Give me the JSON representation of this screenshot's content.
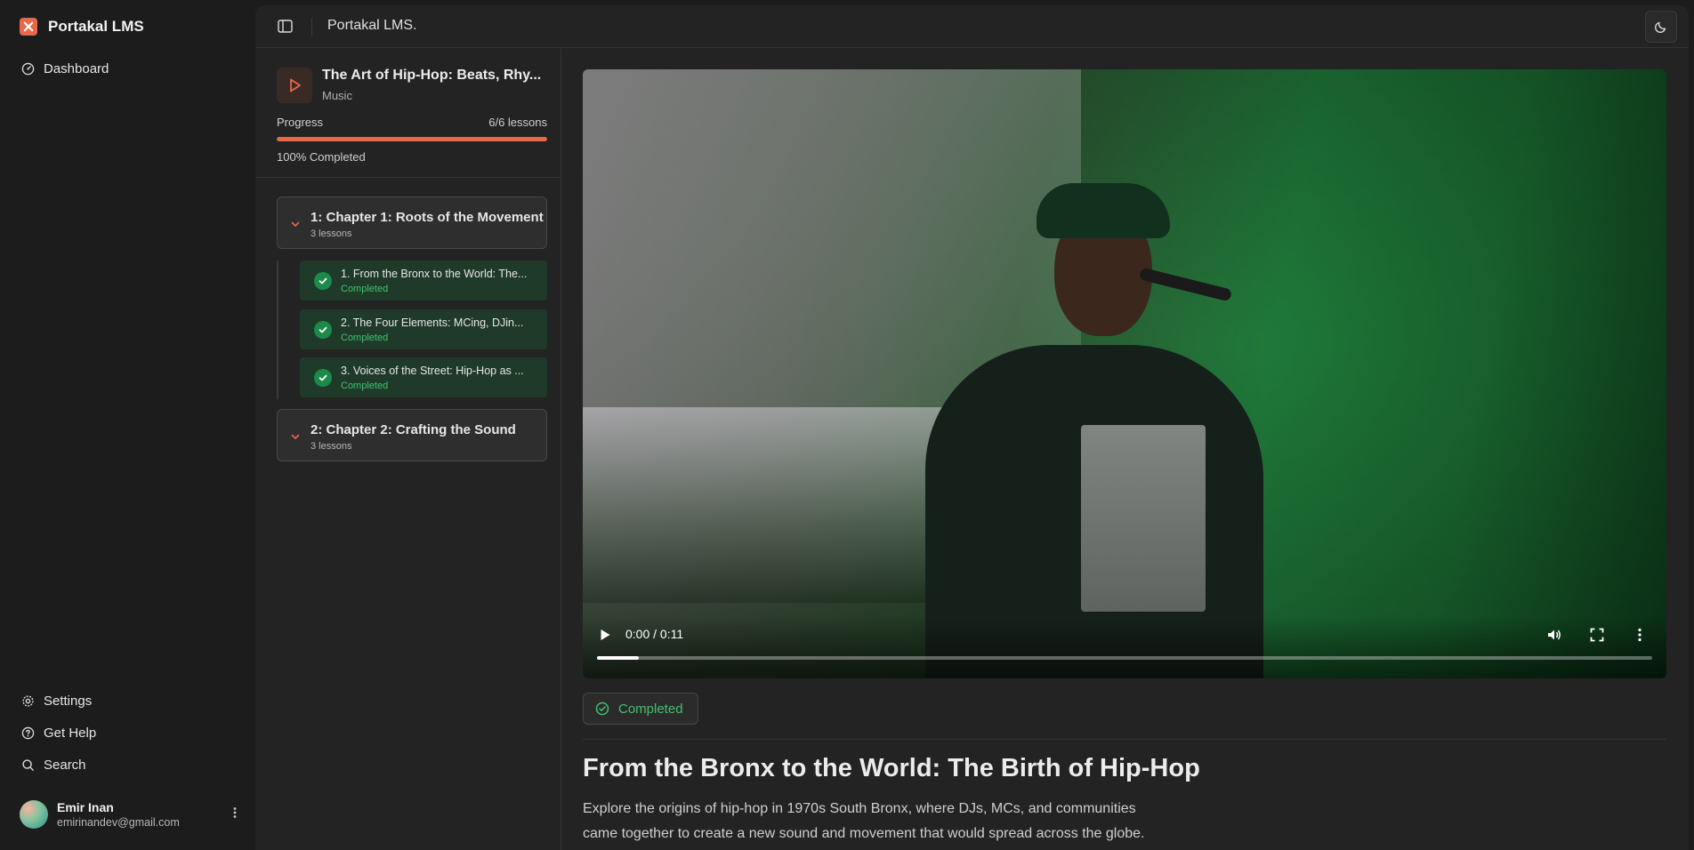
{
  "app": {
    "brand": "Portakal LMS",
    "topbar_title": "Portakal LMS."
  },
  "sidebar": {
    "nav": [
      {
        "label": "Dashboard",
        "icon": "dashboard-icon"
      }
    ],
    "footer_nav": [
      {
        "label": "Settings",
        "icon": "gear-icon"
      },
      {
        "label": "Get Help",
        "icon": "help-icon"
      },
      {
        "label": "Search",
        "icon": "search-icon"
      }
    ],
    "user": {
      "name": "Emir Inan",
      "email": "emirinandev@gmail.com"
    }
  },
  "course": {
    "title": "The Art of Hip-Hop: Beats, Rhy...",
    "category": "Music",
    "progress_label": "Progress",
    "progress_count": "6/6 lessons",
    "progress_fraction": 1.0,
    "progress_text": "100% Completed",
    "chapters": [
      {
        "title": "1: Chapter 1: Roots of the Movement",
        "count": "3 lessons",
        "lessons": [
          {
            "title": "1. From the Bronx to the World: The...",
            "status": "Completed"
          },
          {
            "title": "2. The Four Elements: MCing, DJin...",
            "status": "Completed"
          },
          {
            "title": "3. Voices of the Street: Hip-Hop as ...",
            "status": "Completed"
          }
        ]
      },
      {
        "title": "2: Chapter 2: Crafting the Sound",
        "count": "3 lessons"
      }
    ]
  },
  "video": {
    "time": "0:00 / 0:11",
    "buffered_fraction": 0.04
  },
  "lesson": {
    "status_badge": "Completed",
    "title": "From the Bronx to the World: The Birth of Hip-Hop",
    "description": "Explore the origins of hip-hop in 1970s South Bronx, where DJs, MCs, and communities came together to create a new sound and movement that would spread across the globe."
  },
  "colors": {
    "accent": "#e8694a",
    "success": "#3ec46d",
    "lesson_bg": "#203a2a"
  }
}
